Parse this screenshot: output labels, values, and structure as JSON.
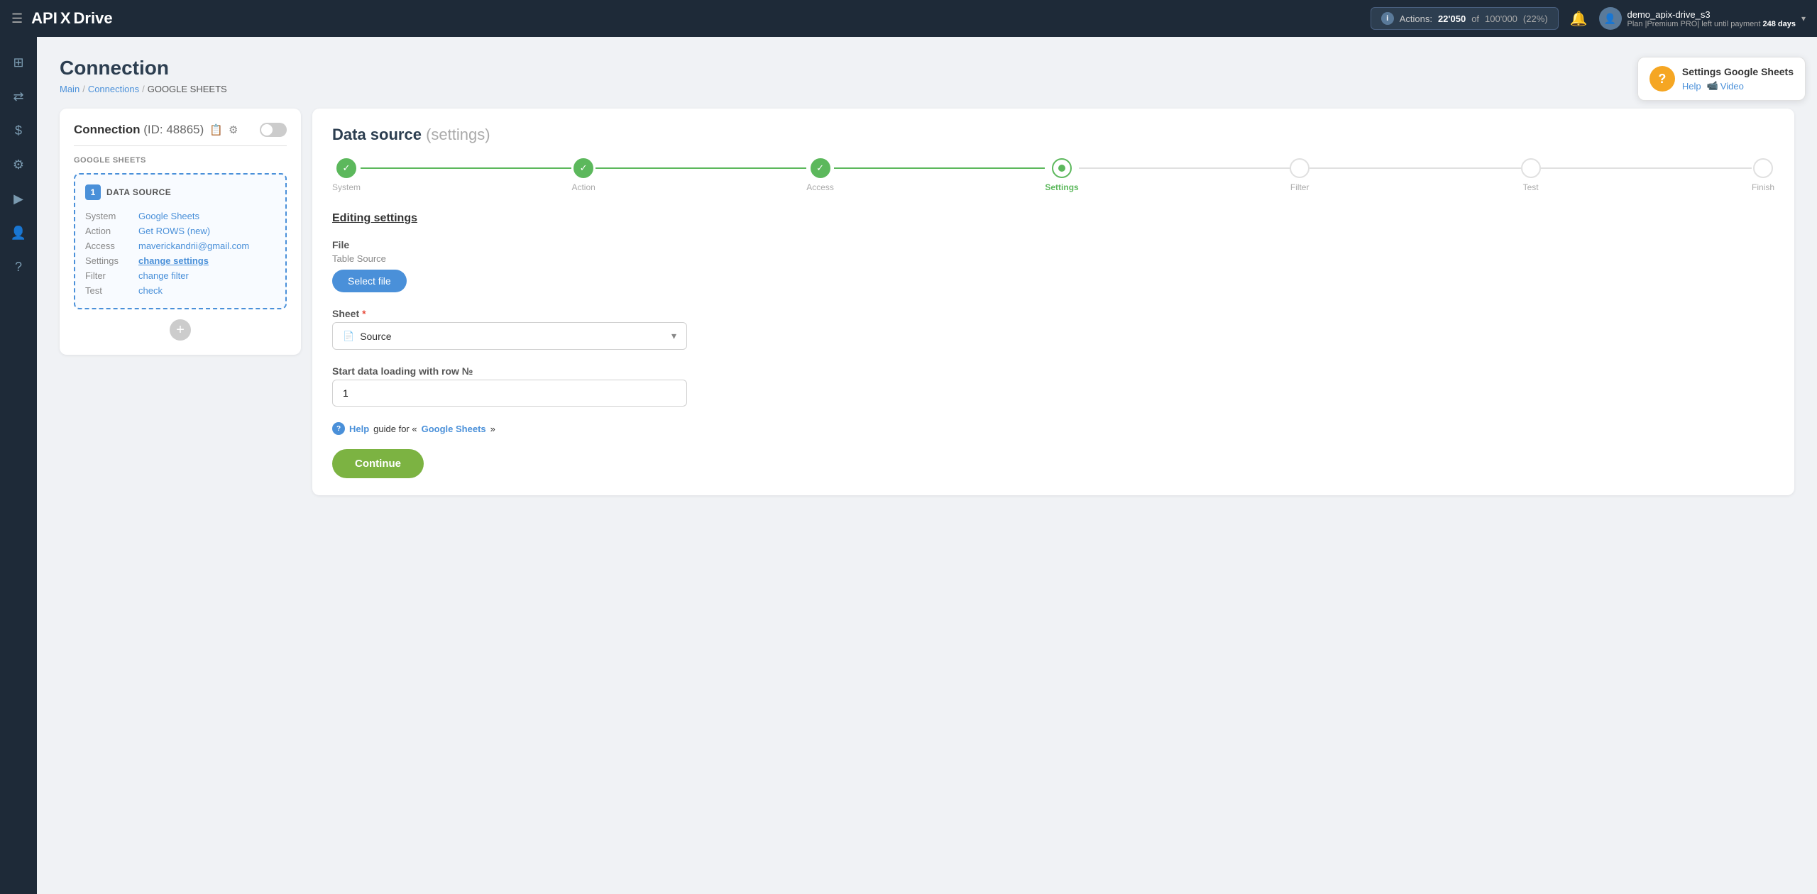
{
  "navbar": {
    "logo": {
      "api": "API",
      "x": "X",
      "drive": "Drive"
    },
    "menu_icon": "☰",
    "actions_label": "Actions:",
    "actions_count": "22'050",
    "actions_of": "of",
    "actions_total": "100'000",
    "actions_percent": "(22%)",
    "bell_icon": "🔔",
    "user_name": "demo_apix-drive_s3",
    "user_plan": "Plan |Premium PRO| left until payment",
    "user_days": "248 days",
    "chevron_down": "▾",
    "info_icon": "i"
  },
  "sidebar": {
    "items": [
      {
        "icon": "⊞",
        "name": "dashboard"
      },
      {
        "icon": "⇄",
        "name": "connections"
      },
      {
        "icon": "$",
        "name": "billing"
      },
      {
        "icon": "⚙",
        "name": "settings"
      },
      {
        "icon": "▶",
        "name": "tutorials"
      },
      {
        "icon": "👤",
        "name": "profile"
      },
      {
        "icon": "?",
        "name": "help"
      }
    ]
  },
  "page": {
    "title": "Connection",
    "breadcrumb": {
      "main": "Main",
      "connections": "Connections",
      "current": "GOOGLE SHEETS"
    }
  },
  "help_tooltip": {
    "title": "Settings Google Sheets",
    "help_label": "Help",
    "video_icon": "📹",
    "video_label": "Video",
    "question_mark": "?"
  },
  "left_panel": {
    "connection_label": "Connection",
    "connection_id": "(ID: 48865)",
    "copy_icon": "📋",
    "gear_icon": "⚙",
    "service_name": "GOOGLE SHEETS",
    "data_source": {
      "number": "1",
      "title": "DATA SOURCE",
      "rows": [
        {
          "label": "System",
          "value": "Google Sheets",
          "is_link": true,
          "bold": false
        },
        {
          "label": "Action",
          "value": "Get ROWS (new)",
          "is_link": true,
          "bold": false
        },
        {
          "label": "Access",
          "value": "maverickandrii@gmail.com",
          "is_link": true,
          "bold": false
        },
        {
          "label": "Settings",
          "value": "change settings",
          "is_link": true,
          "bold": true
        },
        {
          "label": "Filter",
          "value": "change filter",
          "is_link": false,
          "bold": false
        },
        {
          "label": "Test",
          "value": "check",
          "is_link": false,
          "bold": false
        }
      ]
    },
    "add_icon": "+"
  },
  "right_panel": {
    "title": "Data source",
    "title_settings": "(settings)",
    "steps": [
      {
        "label": "System",
        "state": "completed"
      },
      {
        "label": "Action",
        "state": "completed"
      },
      {
        "label": "Access",
        "state": "completed"
      },
      {
        "label": "Settings",
        "state": "active"
      },
      {
        "label": "Filter",
        "state": "inactive"
      },
      {
        "label": "Test",
        "state": "inactive"
      },
      {
        "label": "Finish",
        "state": "inactive"
      }
    ],
    "section_title": "Editing settings",
    "file_label": "File",
    "table_source_label": "Table Source",
    "select_file_btn": "Select file",
    "sheet_label": "Sheet",
    "sheet_required": "*",
    "sheet_value": "Source",
    "sheet_doc_icon": "📄",
    "sheet_chevron": "▾",
    "row_label": "Start data loading with row №",
    "row_value": "1",
    "help_circle": "?",
    "help_link_text": "Help",
    "help_guide_text": "guide for «",
    "help_google_text": "Google Sheets",
    "help_close": "»",
    "continue_btn": "Continue"
  }
}
